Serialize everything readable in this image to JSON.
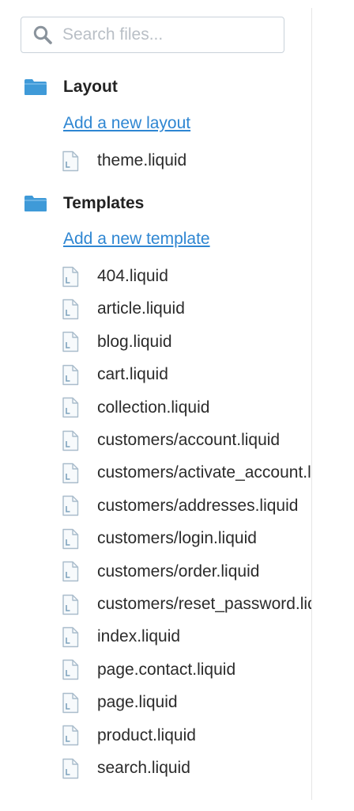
{
  "search": {
    "placeholder": "Search files...",
    "icon": "search-icon"
  },
  "sections": {
    "layout": {
      "title": "Layout",
      "add_link": "Add a new layout",
      "files": [
        "theme.liquid"
      ]
    },
    "templates": {
      "title": "Templates",
      "add_link": "Add a new template",
      "files": [
        "404.liquid",
        "article.liquid",
        "blog.liquid",
        "cart.liquid",
        "collection.liquid",
        "customers/account.liquid",
        "customers/activate_account.liquid",
        "customers/addresses.liquid",
        "customers/login.liquid",
        "customers/order.liquid",
        "customers/reset_password.liquid",
        "index.liquid",
        "page.contact.liquid",
        "page.liquid",
        "product.liquid",
        "search.liquid"
      ]
    }
  },
  "colors": {
    "accent_link": "#2e86d2",
    "folder": "#3f9ad8",
    "file_icon_stroke": "#a9bccb",
    "search_border": "#c9d2da"
  }
}
